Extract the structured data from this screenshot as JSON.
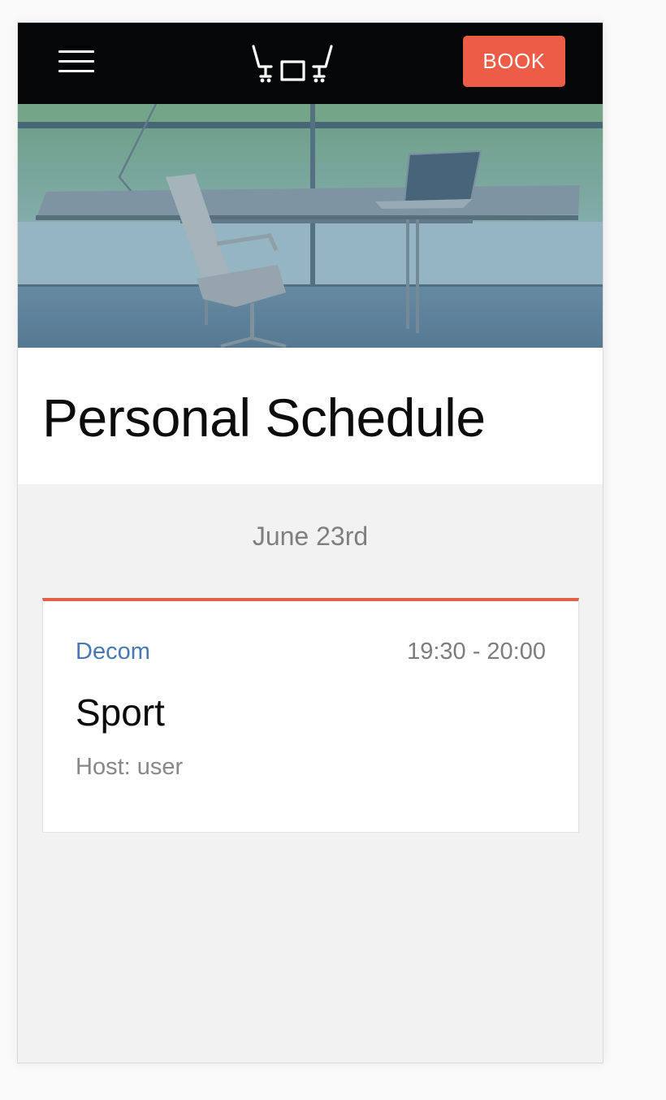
{
  "header": {
    "book_label": "BOOK",
    "colors": {
      "bar": "#040507",
      "accent": "#ec5c47"
    }
  },
  "page": {
    "title": "Personal Schedule"
  },
  "schedule": {
    "date": "June 23rd",
    "events": [
      {
        "location": "Decom",
        "time": "19:30 - 20:00",
        "title": "Sport",
        "host": "Host: user"
      }
    ]
  }
}
